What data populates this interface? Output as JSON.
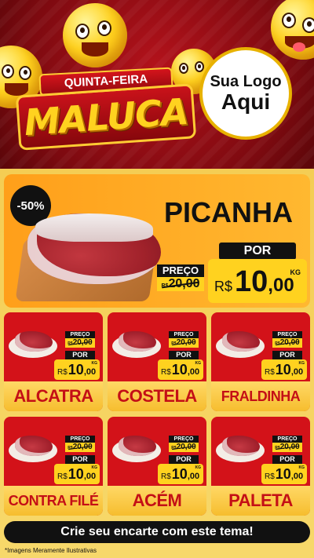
{
  "header": {
    "title_top": "QUINTA-FEIRA",
    "title_main": "MALUCA",
    "logo_line1": "Sua Logo",
    "logo_line2": "Aqui"
  },
  "hero": {
    "discount": "-50%",
    "name": "PICANHA",
    "preco_label": "PREÇO",
    "old_currency": "R$",
    "old_price": "20,00",
    "por_label": "POR",
    "currency": "R$",
    "price_int": "10",
    "price_dec": ",00",
    "unit": "KG"
  },
  "products": [
    {
      "name": "ALCATRA",
      "preco_label": "PREÇO",
      "old_price": "20,00",
      "old_currency": "R$",
      "por_label": "POR",
      "currency": "R$",
      "price_int": "10",
      "price_dec": ",00",
      "unit": "KG"
    },
    {
      "name": "COSTELA",
      "preco_label": "PREÇO",
      "old_price": "20,00",
      "old_currency": "R$",
      "por_label": "POR",
      "currency": "R$",
      "price_int": "10",
      "price_dec": ",00",
      "unit": "KG"
    },
    {
      "name": "FRALDINHA",
      "preco_label": "PREÇO",
      "old_price": "20,00",
      "old_currency": "R$",
      "por_label": "POR",
      "currency": "R$",
      "price_int": "10",
      "price_dec": ",00",
      "unit": "KG"
    },
    {
      "name": "CONTRA FILÉ",
      "preco_label": "PREÇO",
      "old_price": "20,00",
      "old_currency": "R$",
      "por_label": "POR",
      "currency": "R$",
      "price_int": "10",
      "price_dec": ",00",
      "unit": "KG"
    },
    {
      "name": "ACÉM",
      "preco_label": "PREÇO",
      "old_price": "20,00",
      "old_currency": "R$",
      "por_label": "POR",
      "currency": "R$",
      "price_int": "10",
      "price_dec": ",00",
      "unit": "KG"
    },
    {
      "name": "PALETA",
      "preco_label": "PREÇO",
      "old_price": "20,00",
      "old_currency": "R$",
      "por_label": "POR",
      "currency": "R$",
      "price_int": "10",
      "price_dec": ",00",
      "unit": "KG"
    }
  ],
  "footer": {
    "cta": "Crie seu encarte com este tema!",
    "disclaimer": "*Imagens Meramente Ilustrativas"
  },
  "colors": {
    "header_red": "#b3121b",
    "card_red": "#d31219",
    "yellow": "#ffd21f",
    "orange": "#ff9f1a",
    "black": "#111111"
  },
  "icons": [
    "laughing-emoji-icon",
    "meat-cut-icon"
  ]
}
